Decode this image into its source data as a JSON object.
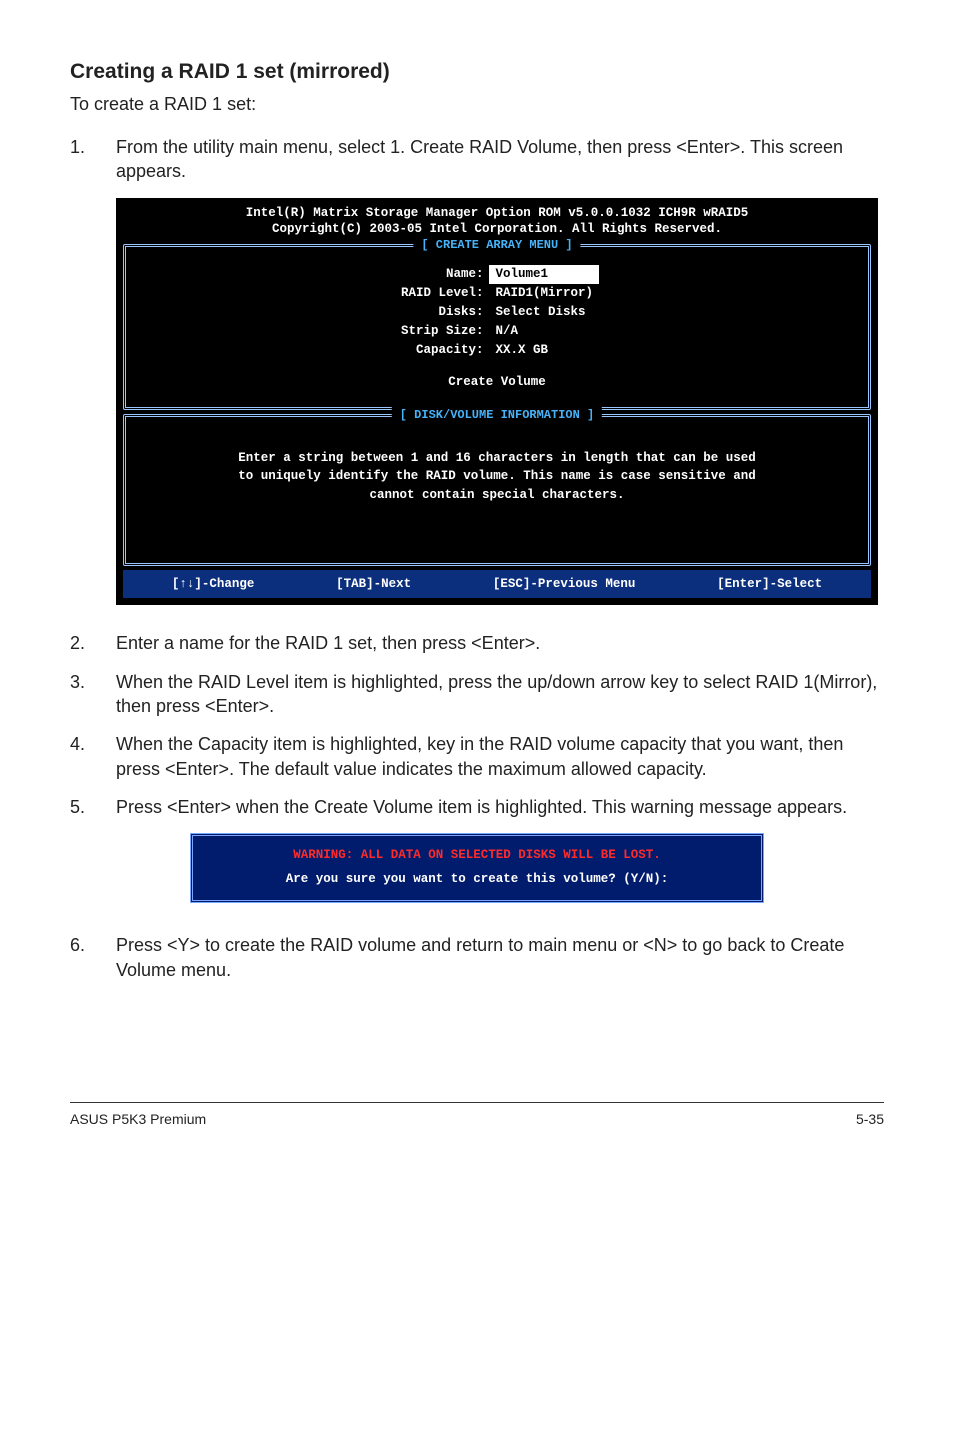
{
  "heading": "Creating a RAID 1 set (mirrored)",
  "intro": "To create a RAID 1 set:",
  "steps": {
    "s1": "From the utility main menu, select 1. Create RAID Volume, then press <Enter>. This screen appears.",
    "s2": "Enter a name for the RAID 1 set, then press <Enter>.",
    "s3": "When the RAID Level item is highlighted, press the up/down arrow key to select RAID 1(Mirror), then press <Enter>.",
    "s4": "When the Capacity item is highlighted, key in the RAID volume capacity that you want, then press <Enter>. The default value indicates the maximum allowed capacity.",
    "s5": "Press <Enter> when the Create Volume item is highlighted. This warning message appears.",
    "s6": "Press <Y> to create the RAID volume and return to main menu or <N> to go back to Create Volume menu."
  },
  "bios": {
    "title1": "Intel(R) Matrix Storage Manager Option ROM v5.0.0.1032 ICH9R wRAID5",
    "title2": "Copyright(C) 2003-05 Intel Corporation. All Rights Reserved.",
    "panel1_label": "[ CREATE ARRAY MENU ]",
    "panel2_label": "[ DISK/VOLUME INFORMATION ]",
    "kv": {
      "name_k": "Name:",
      "name_v": "Volume1",
      "raid_k": "RAID Level:",
      "raid_v": "RAID1(Mirror)",
      "disks_k": "Disks:",
      "disks_v": "Select Disks",
      "strip_k": "Strip Size:",
      "strip_v": "N/A",
      "cap_k": "Capacity:",
      "cap_v": "XX.X  GB"
    },
    "create_volume": "Create Volume",
    "info_l1": "Enter a string between 1 and 16 characters in length that can be used",
    "info_l2": "to uniquely identify the RAID volume. This name is case sensitive and",
    "info_l3": "cannot contain special characters.",
    "footer": {
      "f1": "[↑↓]-Change",
      "f2": "[TAB]-Next",
      "f3": "[ESC]-Previous Menu",
      "f4": "[Enter]-Select"
    }
  },
  "warn": {
    "l1": "WARNING: ALL DATA ON SELECTED DISKS WILL BE LOST.",
    "l2": "Are you sure you want to create this volume? (Y/N):"
  },
  "footer": {
    "left": "ASUS P5K3 Premium",
    "right": "5-35"
  }
}
